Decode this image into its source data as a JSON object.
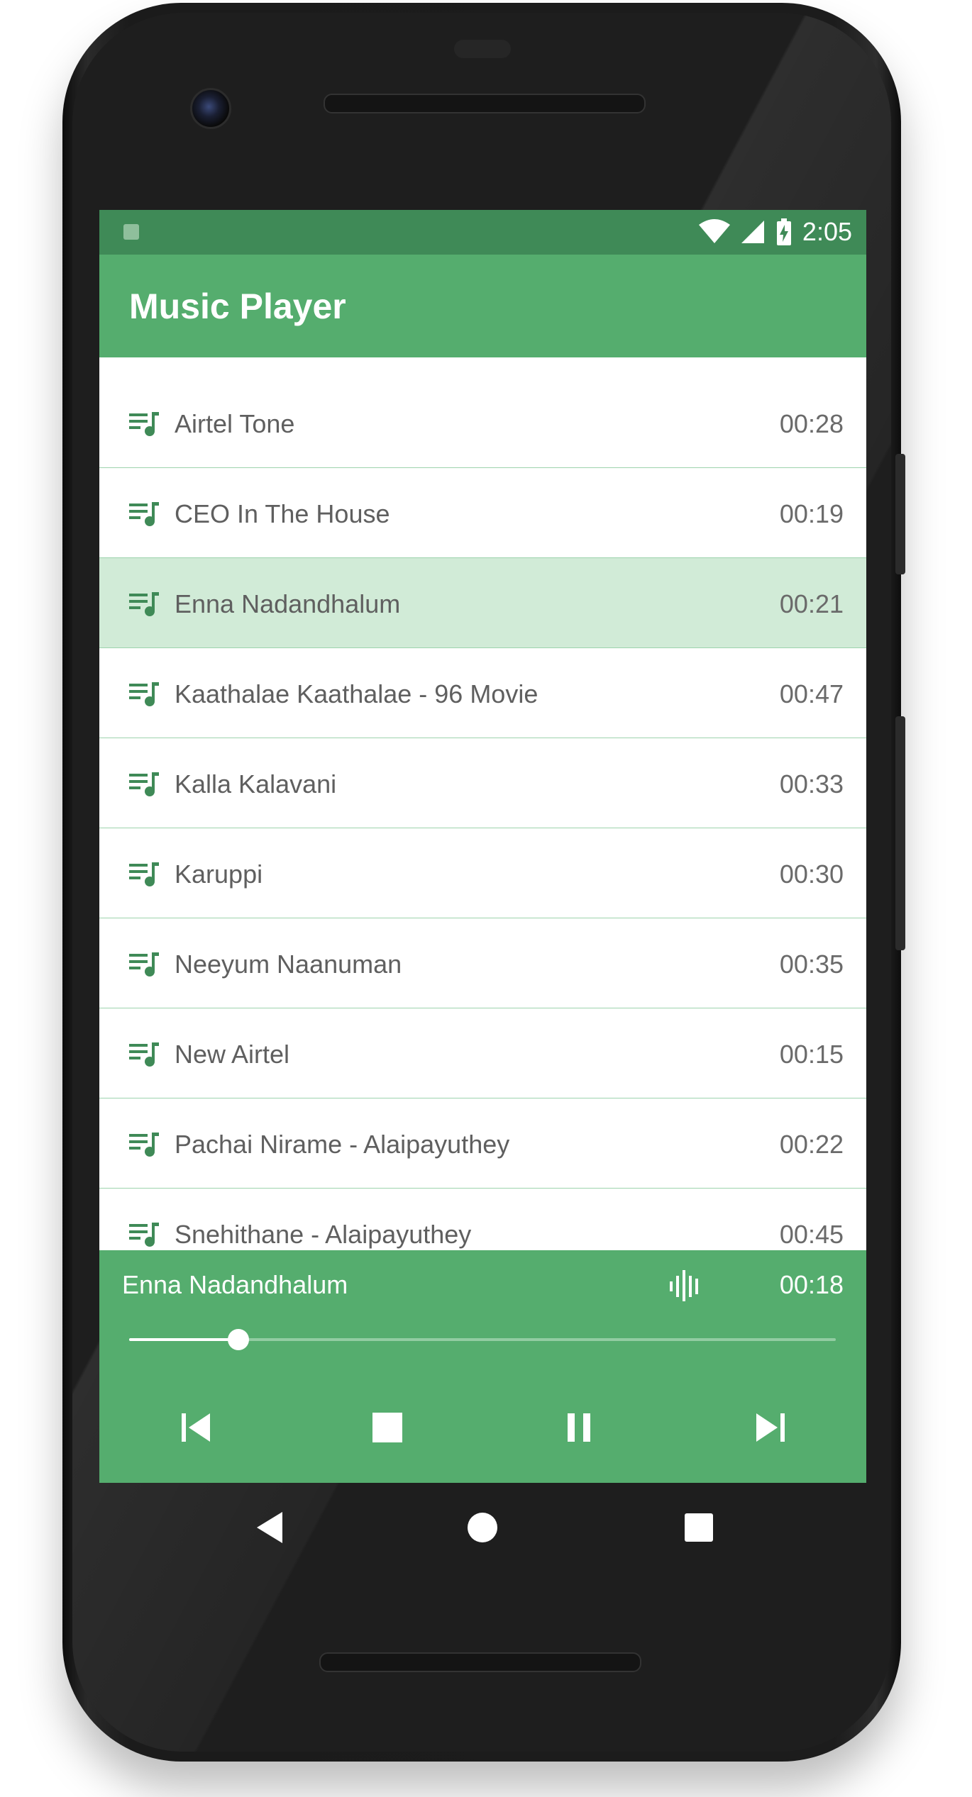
{
  "status_bar": {
    "time": "2:05",
    "icons": [
      "notification-icon",
      "wifi-icon",
      "signal-icon",
      "battery-charging-icon"
    ]
  },
  "app_bar": {
    "title": "Music Player"
  },
  "songs": [
    {
      "title": "Airtel Tone",
      "duration": "00:28"
    },
    {
      "title": "CEO In The House",
      "duration": "00:19"
    },
    {
      "title": "Enna Nadandhalum",
      "duration": "00:21",
      "active": true
    },
    {
      "title": "Kaathalae Kaathalae - 96 Movie",
      "duration": "00:47"
    },
    {
      "title": "Kalla Kalavani",
      "duration": "00:33"
    },
    {
      "title": "Karuppi",
      "duration": "00:30"
    },
    {
      "title": "Neeyum Naanuman",
      "duration": "00:35"
    },
    {
      "title": "New Airtel",
      "duration": "00:15"
    },
    {
      "title": "Pachai Nirame - Alaipayuthey",
      "duration": "00:22"
    },
    {
      "title": "Snehithane - Alaipayuthey",
      "duration": "00:45"
    }
  ],
  "player": {
    "now_playing": "Enna Nadandhalum",
    "elapsed": "00:18",
    "progress_fraction": 0.155,
    "controls": [
      "skip-previous-icon",
      "stop-icon",
      "pause-icon",
      "skip-next-icon"
    ]
  },
  "nav_bar": {
    "buttons": [
      "back-icon",
      "home-icon",
      "recents-icon"
    ]
  },
  "colors": {
    "primary": "#55ad6e",
    "primary_dark": "#3f8a57",
    "active_row": "#d1ebd7",
    "divider": "#9dd3ad",
    "icon_tint": "#3f8a57"
  }
}
